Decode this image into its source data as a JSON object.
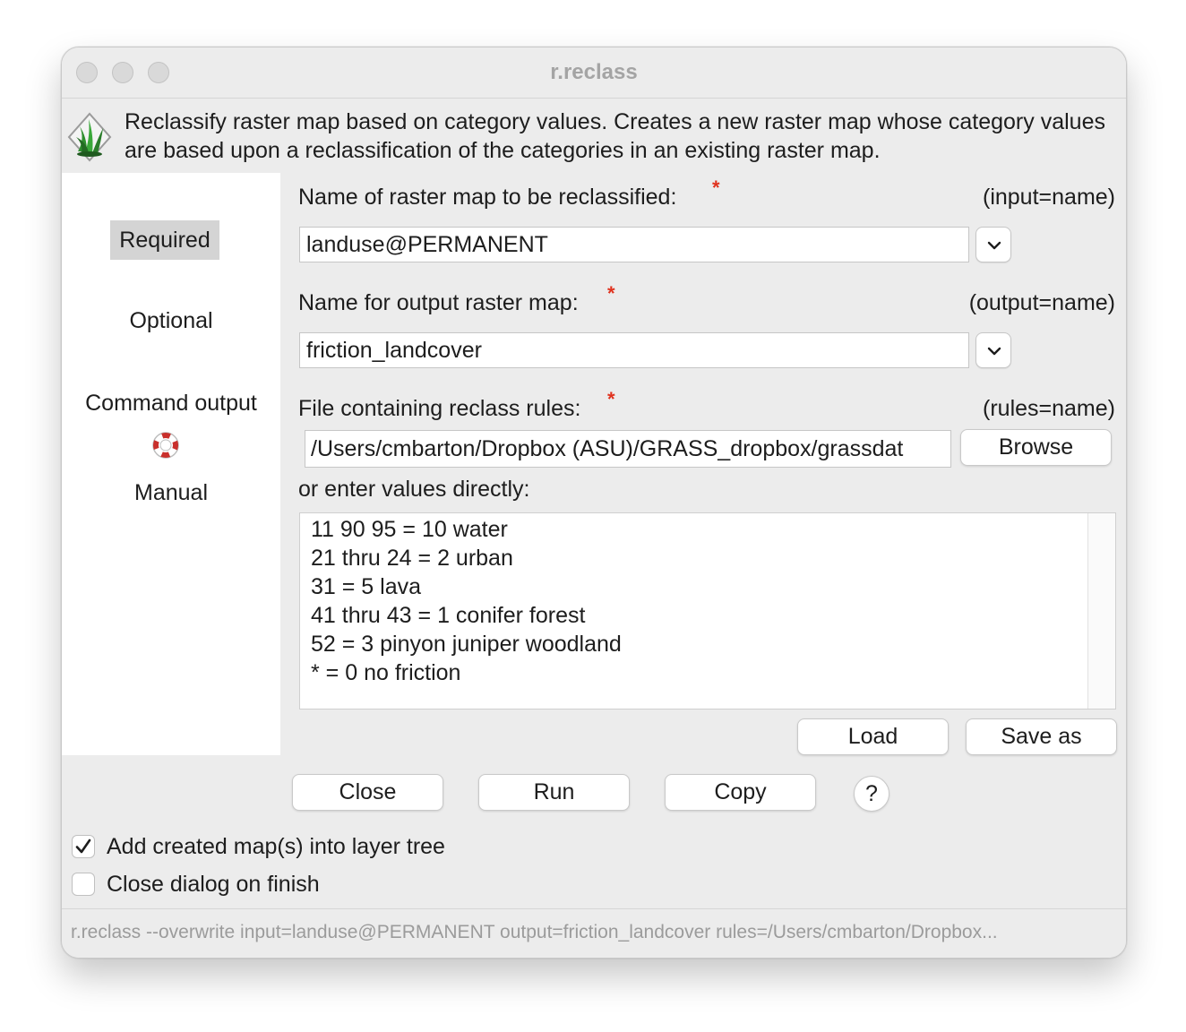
{
  "window": {
    "title": "r.reclass"
  },
  "header": {
    "description": "Reclassify raster map based on category values. Creates a new raster map whose category values are based upon a reclassification of the categories in an existing raster map.",
    "logo_icon": "grass-logo-icon"
  },
  "sidebar": {
    "items": [
      {
        "label": "Required",
        "selected": true
      },
      {
        "label": "Optional",
        "selected": false
      },
      {
        "label": "Command output",
        "selected": false
      },
      {
        "label": "Manual",
        "selected": false
      }
    ],
    "manual_icon": "lifebuoy-icon"
  },
  "form": {
    "input": {
      "label": "Name of raster map to be reclassified:",
      "param": "(input=name)",
      "value": "landuse@PERMANENT",
      "required_mark": "*"
    },
    "output": {
      "label": "Name for output raster map:",
      "param": "(output=name)",
      "value": "friction_landcover",
      "required_mark": "*"
    },
    "rules": {
      "label": "File containing reclass rules:",
      "param": "(rules=name)",
      "value": "/Users/cmbarton/Dropbox (ASU)/GRASS_dropbox/grassdat",
      "required_mark": "*",
      "browse_label": "Browse"
    },
    "direct": {
      "label": "or enter values directly:",
      "lines": [
        "11 90 95 = 10 water",
        "21 thru 24 = 2 urban",
        "31 = 5 lava",
        "41 thru 43 = 1 conifer forest",
        "52 = 3 pinyon juniper woodland",
        "* = 0 no friction"
      ],
      "load_label": "Load",
      "save_label": "Save as"
    }
  },
  "actions": {
    "close_label": "Close",
    "run_label": "Run",
    "copy_label": "Copy",
    "help_label": "?"
  },
  "options": {
    "add_to_tree": {
      "label": "Add created map(s) into layer tree",
      "checked": true
    },
    "close_on_finish": {
      "label": "Close dialog on finish",
      "checked": false
    }
  },
  "statusbar": {
    "command": "r.reclass --overwrite input=landuse@PERMANENT output=friction_landcover rules=/Users/cmbarton/Dropbox..."
  },
  "colors": {
    "required_star": "#e0321e",
    "selected_tab_bg": "#d4d4d4",
    "window_bg": "#ececec"
  }
}
